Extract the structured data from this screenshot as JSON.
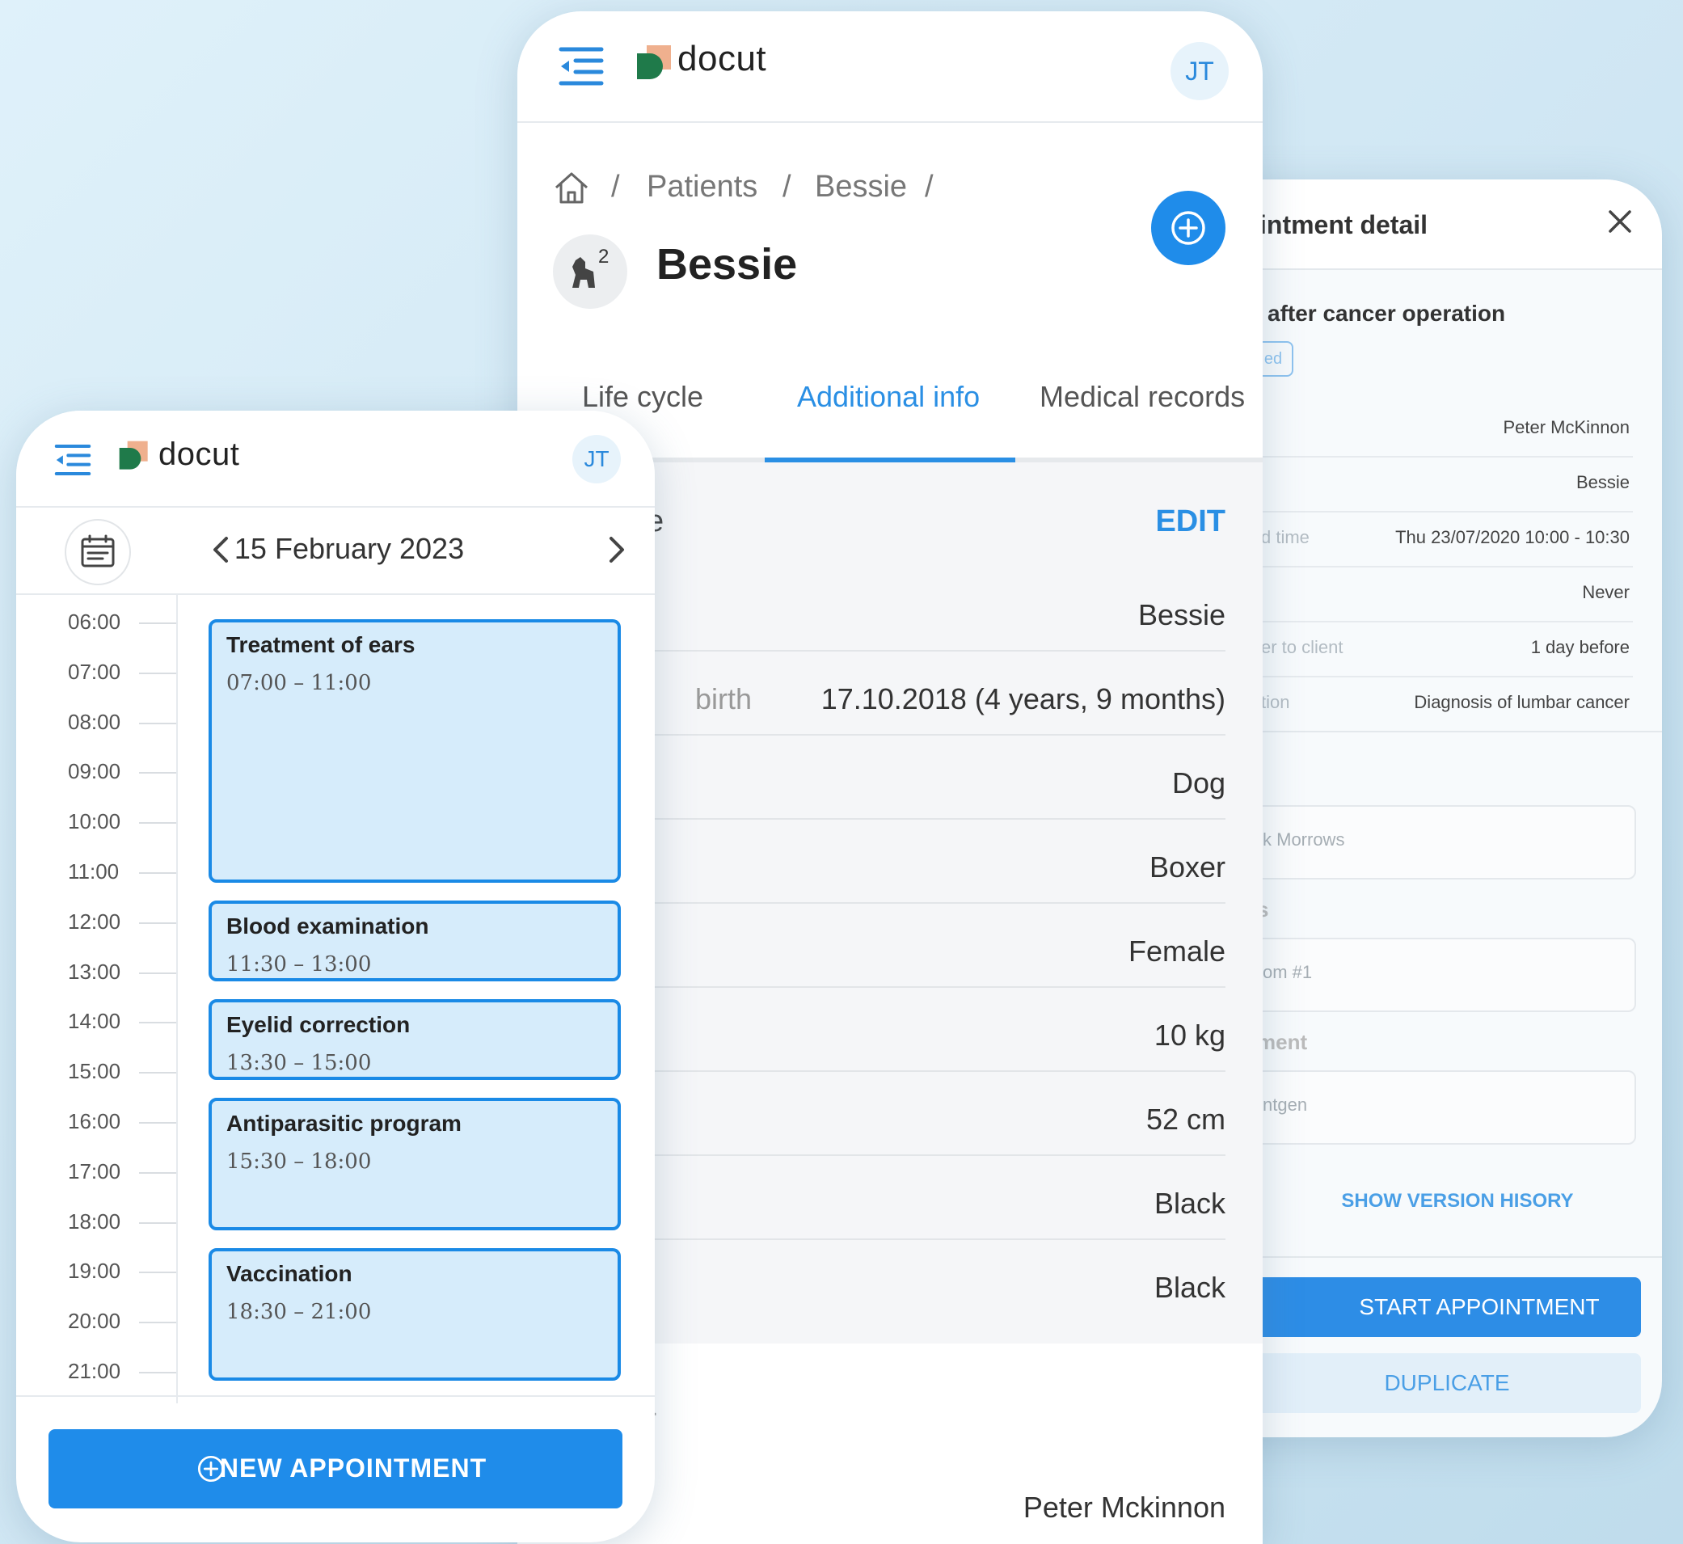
{
  "app": {
    "logo_text": "docut",
    "user_initials": "JT",
    "brand_color": "#1f8cea"
  },
  "detail": {
    "title": "intment detail",
    "subtitle": "after cancer operation",
    "badge": "ed",
    "rows": [
      {
        "label": "",
        "value": "Peter McKinnon"
      },
      {
        "label": "",
        "value": "Bessie"
      },
      {
        "label": "d time",
        "value": "Thu 23/07/2020 10:00 - 10:30"
      },
      {
        "label": "",
        "value": "Never"
      },
      {
        "label": "er to client",
        "value": "1 day before"
      },
      {
        "label": "tion",
        "value": "Diagnosis of lumbar cancer"
      }
    ],
    "field1_value": "k Morrows",
    "section2": "s",
    "field2_value": "om #1",
    "section3": "ment",
    "field3_value": "ntgen",
    "version_link": "SHOW VERSION HISORY",
    "start_button": "START APPOINTMENT",
    "duplicate_button": "DUPLICATE"
  },
  "patient": {
    "breadcrumb": [
      "Patients",
      "Bessie"
    ],
    "separator": "/",
    "name": "Bessie",
    "pet_count": "2",
    "tabs": [
      "Life cycle",
      "Additional info",
      "Medical records"
    ],
    "active_tab": "Additional info",
    "section_label": "e",
    "edit_label": "EDIT",
    "rows": [
      {
        "label": "",
        "value": "Bessie"
      },
      {
        "label": "birth",
        "value": "17.10.2018 (4 years, 9 months)"
      },
      {
        "label": "",
        "value": "Dog"
      },
      {
        "label": "",
        "value": "Boxer"
      },
      {
        "label": "",
        "value": "Female"
      },
      {
        "label": "",
        "value": "10 kg"
      },
      {
        "label": "",
        "value": "52 cm"
      },
      {
        "label": "",
        "value": "Black"
      },
      {
        "label": "",
        "value": "Black"
      }
    ],
    "owner_label": "r",
    "owner_value": "Peter Mckinnon"
  },
  "calendar": {
    "date": "15 February 2023",
    "hours": [
      "06:00",
      "07:00",
      "08:00",
      "09:00",
      "10:00",
      "11:00",
      "12:00",
      "13:00",
      "14:00",
      "15:00",
      "16:00",
      "17:00",
      "18:00",
      "19:00",
      "20:00",
      "21:00"
    ],
    "events": [
      {
        "title": "Treatment of ears",
        "time": "07:00 – 11:00"
      },
      {
        "title": "Blood examination",
        "time": "11:30 – 13:00"
      },
      {
        "title": "Eyelid correction",
        "time": "13:30 – 15:00"
      },
      {
        "title": "Antiparasitic program",
        "time": "15:30 – 18:00"
      },
      {
        "title": "Vaccination",
        "time": "18:30 – 21:00"
      }
    ],
    "new_button": "NEW APPOINTMENT"
  }
}
